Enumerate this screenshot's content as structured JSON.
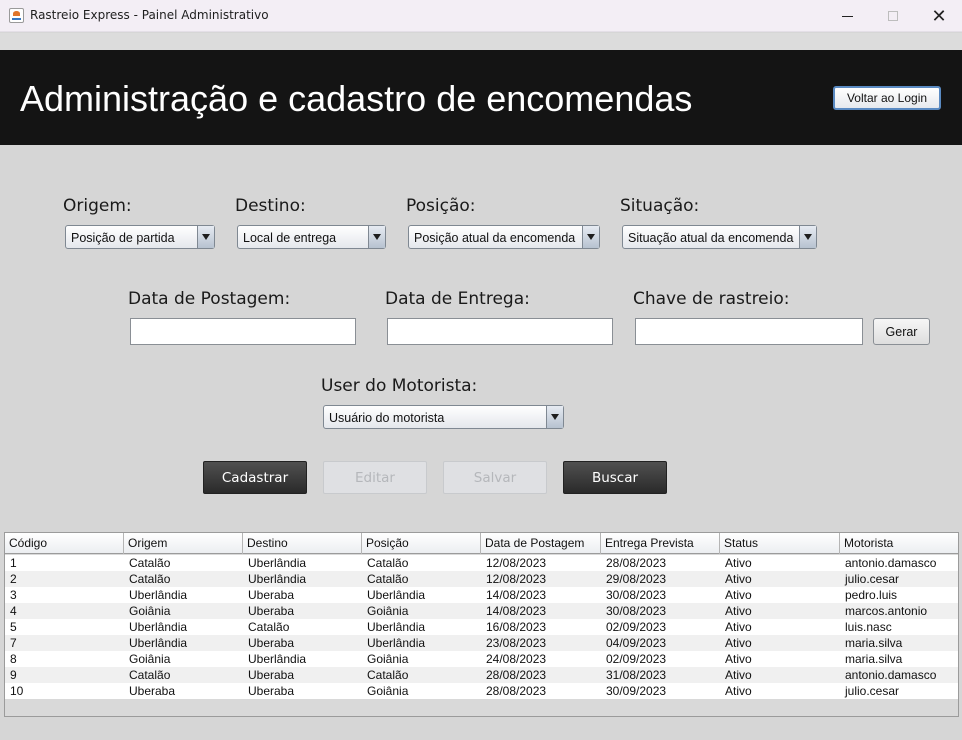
{
  "window": {
    "title": "Rastreio Express - Painel Administrativo",
    "minimize": "",
    "maximize": "",
    "close": "✕"
  },
  "header": {
    "title": "Administração e cadastro de encomendas",
    "back_button": "Voltar ao Login"
  },
  "form": {
    "origem": {
      "label": "Origem:",
      "value": "Posição de partida"
    },
    "destino": {
      "label": "Destino:",
      "value": "Local de entrega"
    },
    "posicao": {
      "label": "Posição:",
      "value": "Posição atual da encomenda"
    },
    "situacao": {
      "label": "Situação:",
      "value": "Situação atual da encomenda"
    },
    "data_postagem": {
      "label": "Data de Postagem:",
      "value": ""
    },
    "data_entrega": {
      "label": "Data de Entrega:",
      "value": ""
    },
    "chave": {
      "label": "Chave de rastreio:",
      "value": ""
    },
    "gerar_button": "Gerar",
    "motorista": {
      "label": "User do Motorista:",
      "value": "Usuário do motorista"
    }
  },
  "actions": {
    "cadastrar": "Cadastrar",
    "editar": "Editar",
    "salvar": "Salvar",
    "buscar": "Buscar"
  },
  "table": {
    "columns": [
      "Código",
      "Origem",
      "Destino",
      "Posição",
      "Data de Postagem",
      "Entrega Prevista",
      "Status",
      "Motorista"
    ],
    "rows": [
      [
        "1",
        "Catalão",
        "Uberlândia",
        "Catalão",
        "12/08/2023",
        "28/08/2023",
        "Ativo",
        "antonio.damasco"
      ],
      [
        "2",
        "Catalão",
        "Uberlândia",
        "Catalão",
        "12/08/2023",
        "29/08/2023",
        "Ativo",
        "julio.cesar"
      ],
      [
        "3",
        "Uberlândia",
        "Uberaba",
        "Uberlândia",
        "14/08/2023",
        "30/08/2023",
        "Ativo",
        "pedro.luis"
      ],
      [
        "4",
        "Goiânia",
        "Uberaba",
        "Goiânia",
        "14/08/2023",
        "30/08/2023",
        "Ativo",
        "marcos.antonio"
      ],
      [
        "5",
        "Uberlândia",
        "Catalão",
        "Uberlândia",
        "16/08/2023",
        "02/09/2023",
        "Ativo",
        "luis.nasc"
      ],
      [
        "7",
        "Uberlândia",
        "Uberaba",
        "Uberlândia",
        "23/08/2023",
        "04/09/2023",
        "Ativo",
        "maria.silva"
      ],
      [
        "8",
        "Goiânia",
        "Uberlândia",
        "Goiânia",
        "24/08/2023",
        "02/09/2023",
        "Ativo",
        "maria.silva"
      ],
      [
        "9",
        "Catalão",
        "Uberaba",
        "Catalão",
        "28/08/2023",
        "31/08/2023",
        "Ativo",
        "antonio.damasco"
      ],
      [
        "10",
        "Uberaba",
        "Uberaba",
        "Goiânia",
        "28/08/2023",
        "30/09/2023",
        "Ativo",
        "julio.cesar"
      ]
    ]
  }
}
